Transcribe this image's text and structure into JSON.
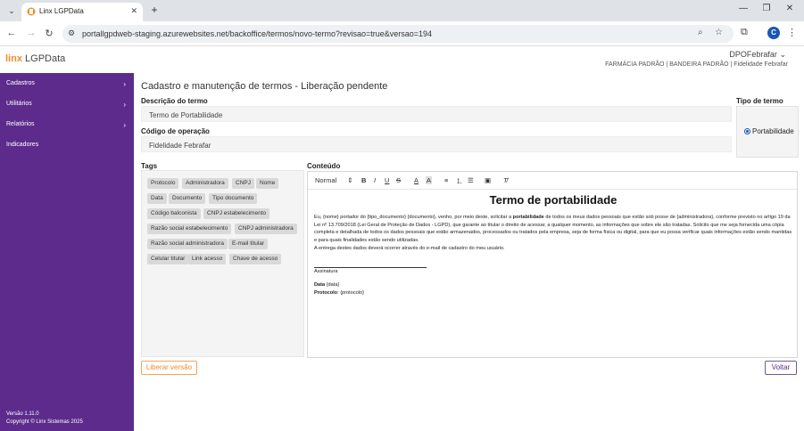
{
  "browser": {
    "tab_title": "Linx LGPData",
    "url": "portallgpdweb-staging.azurewebsites.net/backoffice/termos/novo-termo?revisao=true&versao=194",
    "profile_initial": "C"
  },
  "header": {
    "logo_brand": "linx",
    "logo_product": "LGPData",
    "user": "DPOFebrafar",
    "company": "FARMÁCIA PADRÃO | BANDEIRA PADRÃO | Fidelidade Febrafar"
  },
  "sidebar": {
    "items": [
      {
        "label": "Cadastros",
        "chevron": "›"
      },
      {
        "label": "Utilitários",
        "chevron": "›"
      },
      {
        "label": "Relatórios",
        "chevron": "›"
      },
      {
        "label": "Indicadores",
        "chevron": ""
      }
    ],
    "version": "Versão 1.11.0",
    "copyright": "Copyright © Linx Sistemas 2025"
  },
  "main": {
    "page_title": "Cadastro e manutenção de termos - Liberação pendente",
    "descricao_label": "Descrição do termo",
    "descricao_value": "Termo de Portabilidade",
    "codigo_label": "Código de operação",
    "codigo_value": "Fidelidade Febrafar",
    "tipo_label": "Tipo de termo",
    "tipo_option": "Portabilidade",
    "tags_label": "Tags",
    "conteudo_label": "Conteúdo",
    "tags": [
      "Protocolo",
      "Administradora",
      "CNPJ",
      "Nome",
      "Data",
      "Documento",
      "Tipo documento",
      "Código balconista",
      "CNPJ estabelecimento",
      "Razão social estabelecimento",
      "CNPJ administradora",
      "Razão social administradora",
      "E-mail titular",
      "Celular titular",
      "Link acesso",
      "Chave de acesso"
    ],
    "editor": {
      "format": "Normal",
      "doc_title": "Termo de portabilidade",
      "p1_a": "Eu, {nome} portador do {tipo_documento} {documento}, venho, por meio deste, solicitar a ",
      "p1_bold": "portabilidade",
      "p1_b": " de todos os meus dados pessoais que estão sob posse de {administradora}, conforme previsto no artigo 19 da Lei nº 13.709/2018 (Lei Geral de Proteção de Dados - LGPD), que garante ao titular o direito de acessar, a qualquer momento, as informações que sobre ele são tratadas. Solicito que me seja fornecida uma cópia completa e detalhada de todos os dados pessoais que estão armazenados, processados ou tratados pela empresa, seja de forma física ou digital, para que eu possa verificar quais informações estão sendo mantidas e para quais finalidades estão sendo utilizadas.",
      "p2": "A entrega destes dados deverá ocorrer através do e-mail de cadastro do meu usuário.",
      "signature": "Assinatura",
      "data_label": "Data",
      "data_value": " {data}",
      "protocolo_label": "Protocolo",
      "protocolo_value": ": {protocolo}"
    },
    "btn_liberar": "Liberar versão",
    "btn_voltar": "Voltar"
  },
  "colors": {
    "sidebar": "#5d2b8c",
    "accent_orange": "#f28c28"
  }
}
